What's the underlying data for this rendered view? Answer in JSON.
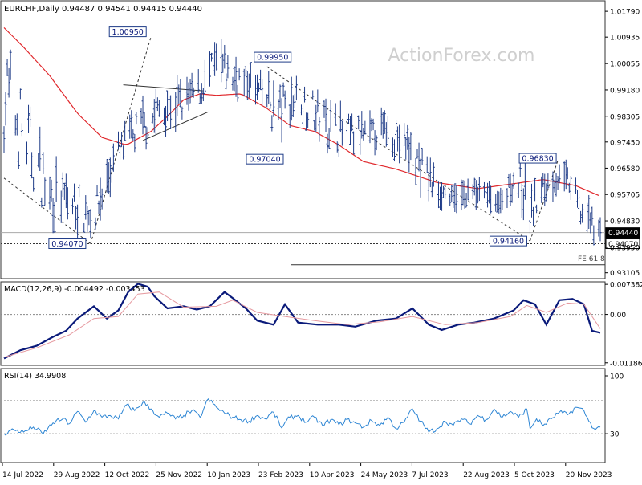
{
  "header": {
    "symbol": "EURCHF,Daily",
    "ohlc": "0.94487 0.94541 0.94415 0.94440"
  },
  "watermark": "ActionForex.com",
  "colors": {
    "background": "#ffffff",
    "bars": "#1f3c88",
    "sma": "#e0282c",
    "macd_line": "#0a1a7a",
    "macd_signal": "#e69aa0",
    "rsi": "#2e86d4",
    "guide": "#666666",
    "frame": "#333333"
  },
  "chart_data": [
    {
      "panel": "price",
      "type": "ohlc",
      "yticks": [
        "1.01790",
        "1.00935",
        "1.00055",
        "0.99180",
        "0.98305",
        "0.97450",
        "0.96580",
        "0.95705",
        "0.94830",
        "0.93950",
        "0.93105"
      ],
      "ylim": [
        0.9291,
        1.0214
      ],
      "price_labels": [
        {
          "text": "0.94440",
          "value": 0.9444,
          "dark": true
        },
        {
          "text": "0.94070",
          "value": 0.9407,
          "dark": false
        }
      ],
      "annotations": [
        {
          "text": "1.00950",
          "value": 1.0095,
          "day": 90
        },
        {
          "text": "0.99950",
          "value": 0.9995,
          "day": 161
        },
        {
          "text": "0.97040",
          "value": 0.9704,
          "day": 168
        },
        {
          "text": "0.94070",
          "value": 0.9407,
          "day": 53
        },
        {
          "text": "0.94160",
          "value": 0.9416,
          "day": 322
        },
        {
          "text": "0.96830",
          "value": 0.9683,
          "day": 339
        }
      ],
      "fe_label": "FE 61.8",
      "fe_level": 0.9337,
      "pivots": [
        [
          0.964,
          1.0198
        ],
        [
          0.9538,
          0.9949
        ],
        [
          0.9445,
          0.9706
        ],
        [
          0.9407,
          0.9592
        ],
        [
          0.9595,
          0.9786
        ],
        [
          0.969,
          0.9875
        ],
        [
          0.9745,
          0.9955
        ],
        [
          0.979,
          0.9965
        ],
        [
          0.9845,
          0.999
        ],
        [
          0.991,
          1.0095
        ],
        [
          0.988,
          1.004
        ],
        [
          0.989,
          1.0
        ],
        [
          0.9704,
          0.9982
        ],
        [
          0.981,
          0.9995
        ],
        [
          0.9735,
          0.9945
        ],
        [
          0.968,
          0.988
        ],
        [
          0.97,
          0.983
        ],
        [
          0.973,
          0.985
        ],
        [
          0.96,
          0.982
        ],
        [
          0.954,
          0.967
        ],
        [
          0.952,
          0.959
        ],
        [
          0.954,
          0.962
        ],
        [
          0.9525,
          0.961
        ],
        [
          0.952,
          0.9565
        ],
        [
          0.9556,
          0.968
        ],
        [
          0.947,
          0.97
        ],
        [
          0.941,
          0.96
        ],
        [
          0.95,
          0.9655
        ],
        [
          0.956,
          0.9683
        ],
        [
          0.957,
          0.967
        ],
        [
          0.942,
          0.963
        ],
        [
          0.9415,
          0.948
        ]
      ],
      "pivot_days": [
        0,
        14,
        28,
        55,
        68,
        82,
        96,
        110,
        120,
        130,
        140,
        150,
        168,
        180,
        190,
        205,
        220,
        235,
        250,
        262,
        275,
        285,
        295,
        303,
        312,
        318,
        322,
        328,
        336,
        345,
        352,
        365
      ],
      "sma_values": [
        1.0125,
        1.006,
        0.9965,
        0.984,
        0.976,
        0.9735,
        0.978,
        0.983,
        0.9885,
        0.9905,
        0.99,
        0.9905,
        0.986,
        0.98,
        0.978,
        0.9735,
        0.968,
        0.9655,
        0.961,
        0.959,
        0.9605,
        0.962,
        0.96,
        0.9565
      ],
      "sma_days": [
        0,
        12,
        28,
        45,
        60,
        75,
        90,
        100,
        110,
        120,
        130,
        145,
        160,
        175,
        190,
        205,
        220,
        240,
        265,
        290,
        310,
        330,
        350,
        365
      ],
      "trendlines": [
        {
          "d1": 0,
          "v1": 0.9625,
          "d2": 53,
          "v2": 0.9407,
          "style": "dashed"
        },
        {
          "d1": 53,
          "v1": 0.9407,
          "d2": 90,
          "v2": 1.0095,
          "style": "dashed"
        },
        {
          "d1": 161,
          "v1": 0.9995,
          "d2": 210,
          "v2": 0.981,
          "style": "dashed"
        },
        {
          "d1": 210,
          "v1": 0.981,
          "d2": 322,
          "v2": 0.9416,
          "style": "dashed"
        },
        {
          "d1": 322,
          "v1": 0.9416,
          "d2": 339,
          "v2": 0.9683,
          "style": "dashed"
        },
        {
          "d1": 73,
          "v1": 0.9935,
          "d2": 122,
          "v2": 0.9915,
          "style": "solid"
        },
        {
          "d1": 85,
          "v1": 0.975,
          "d2": 125,
          "v2": 0.9845,
          "style": "solid"
        }
      ]
    },
    {
      "panel": "macd",
      "type": "line",
      "title": "MACD(12,26,9) -0.004492 -0.003453",
      "yticks": [
        "0.007382",
        "0.00",
        "-0.011867"
      ],
      "ylim": [
        -0.0125,
        0.008
      ],
      "series": [
        {
          "name": "MACD",
          "points": [
            [
              0,
              -0.0108
            ],
            [
              10,
              -0.0088
            ],
            [
              20,
              -0.0077
            ],
            [
              30,
              -0.0055
            ],
            [
              38,
              -0.004
            ],
            [
              45,
              -0.001
            ],
            [
              55,
              0.002
            ],
            [
              63,
              -0.001
            ],
            [
              70,
              0.001
            ],
            [
              76,
              0.0055
            ],
            [
              82,
              0.0075
            ],
            [
              88,
              0.0068
            ],
            [
              92,
              0.0045
            ],
            [
              100,
              0.0015
            ],
            [
              110,
              0.002
            ],
            [
              118,
              0.0012
            ],
            [
              126,
              0.002
            ],
            [
              135,
              0.0055
            ],
            [
              140,
              0.004
            ],
            [
              148,
              0.0015
            ],
            [
              155,
              -0.0015
            ],
            [
              165,
              -0.0025
            ],
            [
              172,
              0.0025
            ],
            [
              180,
              -0.002
            ],
            [
              192,
              -0.0025
            ],
            [
              205,
              -0.0025
            ],
            [
              215,
              -0.003
            ],
            [
              228,
              -0.0015
            ],
            [
              240,
              -0.001
            ],
            [
              250,
              0.0015
            ],
            [
              260,
              -0.0025
            ],
            [
              268,
              -0.0038
            ],
            [
              278,
              -0.0025
            ],
            [
              288,
              -0.002
            ],
            [
              300,
              -0.001
            ],
            [
              312,
              0.001
            ],
            [
              318,
              0.0035
            ],
            [
              325,
              0.0025
            ],
            [
              332,
              -0.0025
            ],
            [
              340,
              0.0035
            ],
            [
              348,
              0.0038
            ],
            [
              355,
              0.0025
            ],
            [
              360,
              -0.004
            ],
            [
              365,
              -0.0045
            ]
          ]
        },
        {
          "name": "Signal",
          "points": [
            [
              0,
              -0.0105
            ],
            [
              20,
              -0.0082
            ],
            [
              40,
              -0.005
            ],
            [
              55,
              -0.001
            ],
            [
              70,
              -0.0005
            ],
            [
              82,
              0.005
            ],
            [
              95,
              0.0055
            ],
            [
              110,
              0.0018
            ],
            [
              130,
              0.002
            ],
            [
              140,
              0.0035
            ],
            [
              155,
              0.0005
            ],
            [
              172,
              -0.0005
            ],
            [
              190,
              -0.0015
            ],
            [
              210,
              -0.0025
            ],
            [
              230,
              -0.0018
            ],
            [
              250,
              -0.0005
            ],
            [
              270,
              -0.0025
            ],
            [
              290,
              -0.002
            ],
            [
              310,
              -0.0005
            ],
            [
              320,
              0.0022
            ],
            [
              332,
              0.0005
            ],
            [
              345,
              0.0028
            ],
            [
              355,
              0.0025
            ],
            [
              365,
              -0.0035
            ]
          ]
        }
      ]
    },
    {
      "panel": "rsi",
      "type": "line",
      "title": "RSI(14) 34.9908",
      "yticks": [
        "100",
        "70",
        "30",
        "0"
      ],
      "ylim": [
        0,
        100
      ],
      "series": [
        {
          "name": "RSI",
          "points": [
            [
              0,
              30
            ],
            [
              6,
              35
            ],
            [
              12,
              32
            ],
            [
              18,
              38
            ],
            [
              24,
              30
            ],
            [
              30,
              43
            ],
            [
              36,
              48
            ],
            [
              40,
              42
            ],
            [
              45,
              57
            ],
            [
              50,
              44
            ],
            [
              55,
              58
            ],
            [
              60,
              50
            ],
            [
              65,
              52
            ],
            [
              70,
              48
            ],
            [
              75,
              65
            ],
            [
              80,
              58
            ],
            [
              85,
              68
            ],
            [
              90,
              60
            ],
            [
              95,
              50
            ],
            [
              100,
              55
            ],
            [
              105,
              48
            ],
            [
              110,
              52
            ],
            [
              115,
              58
            ],
            [
              120,
              50
            ],
            [
              125,
              72
            ],
            [
              130,
              62
            ],
            [
              135,
              55
            ],
            [
              140,
              50
            ],
            [
              145,
              47
            ],
            [
              150,
              45
            ],
            [
              155,
              52
            ],
            [
              160,
              48
            ],
            [
              165,
              56
            ],
            [
              170,
              37
            ],
            [
              175,
              50
            ],
            [
              180,
              52
            ],
            [
              185,
              44
            ],
            [
              190,
              50
            ],
            [
              195,
              40
            ],
            [
              200,
              47
            ],
            [
              205,
              41
            ],
            [
              210,
              47
            ],
            [
              215,
              43
            ],
            [
              220,
              38
            ],
            [
              225,
              46
            ],
            [
              230,
              40
            ],
            [
              235,
              50
            ],
            [
              240,
              36
            ],
            [
              245,
              44
            ],
            [
              250,
              60
            ],
            [
              255,
              45
            ],
            [
              260,
              32
            ],
            [
              265,
              36
            ],
            [
              270,
              45
            ],
            [
              275,
              40
            ],
            [
              280,
              48
            ],
            [
              285,
              42
            ],
            [
              290,
              52
            ],
            [
              295,
              47
            ],
            [
              300,
              60
            ],
            [
              305,
              50
            ],
            [
              310,
              57
            ],
            [
              315,
              50
            ],
            [
              320,
              60
            ],
            [
              322,
              36
            ],
            [
              326,
              48
            ],
            [
              330,
              40
            ],
            [
              335,
              48
            ],
            [
              340,
              56
            ],
            [
              345,
              53
            ],
            [
              350,
              62
            ],
            [
              355,
              58
            ],
            [
              358,
              45
            ],
            [
              362,
              35
            ],
            [
              365,
              38
            ]
          ]
        }
      ]
    },
    {
      "panel": "xaxis",
      "type": "axis",
      "categories": [
        "14 Jul 2022",
        "29 Aug 2022",
        "12 Oct 2022",
        "25 Nov 2022",
        "10 Jan 2023",
        "23 Feb 2023",
        "10 Apr 2023",
        "24 May 2023",
        "7 Jul 2023",
        "22 Aug 2023",
        "5 Oct 2023",
        "20 Nov 2023"
      ]
    }
  ]
}
